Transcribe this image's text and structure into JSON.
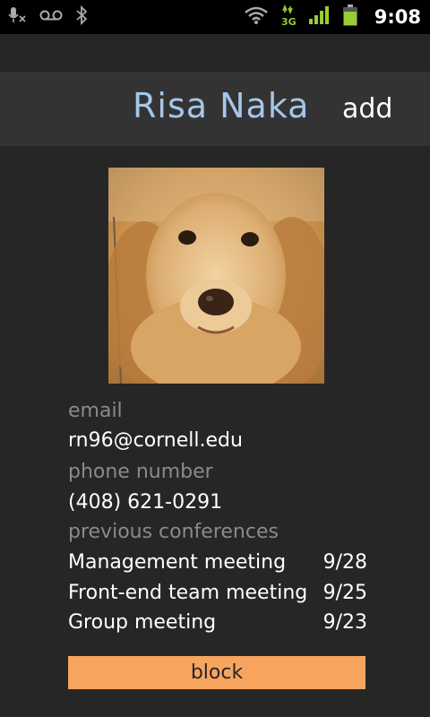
{
  "status_bar": {
    "time": "9:08",
    "network": "3G",
    "icons": [
      "mic-muted-icon",
      "voicemail-icon",
      "bluetooth-icon",
      "wifi-icon",
      "data-3g-icon",
      "signal-icon",
      "battery-icon"
    ],
    "accent": "#99cc33"
  },
  "header": {
    "name": "Risa Naka",
    "add_label": "add"
  },
  "profile": {
    "photo_subject": "golden retriever"
  },
  "fields": {
    "email_label": "email",
    "email_value": "rn96@cornell.edu",
    "phone_label": "phone number",
    "phone_value": "(408) 621-0291",
    "conferences_label": "previous conferences"
  },
  "conferences": [
    {
      "title": "Management meeting",
      "date": "9/28"
    },
    {
      "title": "Front-end team meeting",
      "date": "9/25"
    },
    {
      "title": "Group meeting",
      "date": "9/23"
    }
  ],
  "actions": {
    "block_label": "block",
    "block_color": "#f7a45f"
  }
}
